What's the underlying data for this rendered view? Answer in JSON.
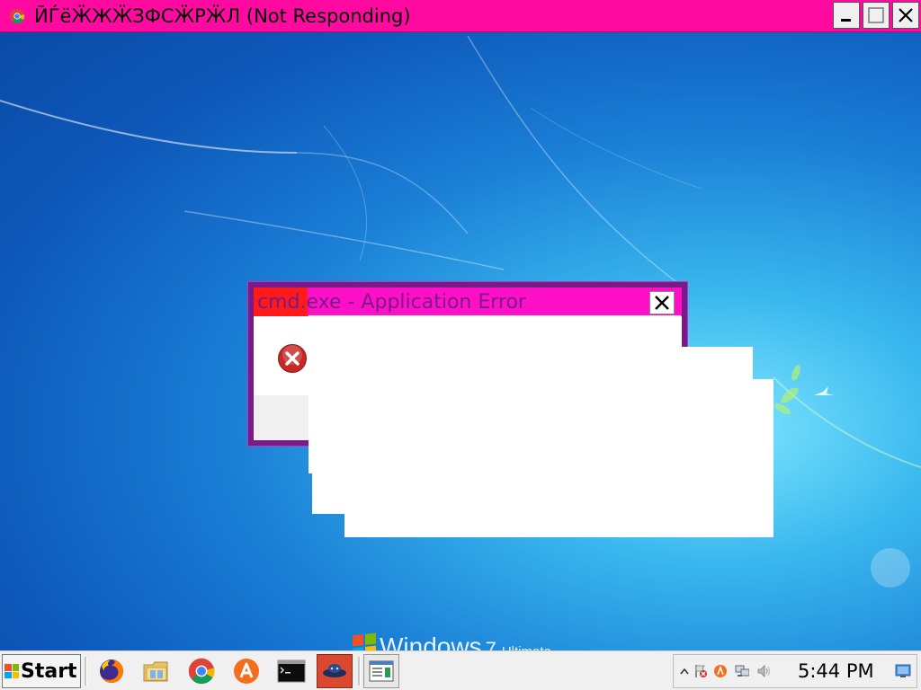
{
  "window": {
    "title": "ӢЃёӜЖӜЗФСӜРӜЛ (Not Responding)",
    "icon": "chrome-icon",
    "minimize_icon": "minimize-icon",
    "maximize_icon": "maximize-icon",
    "close_icon": "close-icon"
  },
  "dialog": {
    "title": "cmd.exe - Application Error",
    "icon": "error-icon",
    "close_icon": "close-icon"
  },
  "desktop": {
    "brand_word": "Windows",
    "brand_version": "7",
    "brand_edition": "Ultimate"
  },
  "taskbar": {
    "start_label": "Start",
    "pinned": [
      {
        "name": "firefox-icon"
      },
      {
        "name": "file-explorer-icon"
      },
      {
        "name": "chrome-icon"
      },
      {
        "name": "avast-icon"
      },
      {
        "name": "command-prompt-icon"
      },
      {
        "name": "app-icon"
      },
      {
        "name": "window-preview-icon"
      }
    ],
    "tray": {
      "clock": "5:44 PM",
      "icons": [
        "show-hidden-icons-icon",
        "action-center-icon",
        "avast-tray-icon",
        "network-icon",
        "volume-icon",
        "show-desktop-icon"
      ]
    }
  },
  "colors": {
    "title_bar": "#ff0aa0",
    "dialog_frame": "#7a1a86",
    "dialog_title_bar": "#ff10c8",
    "taskbar": "#f0f0f0"
  }
}
